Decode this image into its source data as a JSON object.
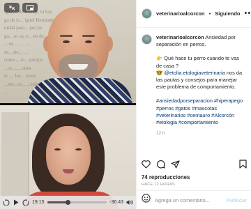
{
  "video": {
    "wall_text": "Qua... Me lo... ay, lo hay\ngo de lo... iguel Hernández \nuidad para... por pa\ngo... or os, e... no de\n... es...  ...  ...\nse... ste...  ...\ncome..., la... porque\n...ce..., ...ones\nte ...  los... rosas\n...nté...ce... ...erdas\n...",
    "time_elapsed": "19:15",
    "time_remaining": "-36:43",
    "progress": 0.35
  },
  "header": {
    "username": "veterinarioalcorcon",
    "separator": "•",
    "follow_state": "Siguiendo",
    "more_label": "•••"
  },
  "caption": {
    "username": "veterinarioalcorcon",
    "line1": "Ansiedad por separación en perros.",
    "line2": "👉 Qué hace tu perro cuando te vas de casa ?",
    "line3_prefix": "🤓 ",
    "line3_mention": "@etolia.etologiaveterinaria",
    "line3_rest": " nos da las pautas y consejos para manejar este problema de comportamiento.",
    "hashtags": "#ansiedadporseparacion #hiperapego #perros #gatos #mascotas #veterinarios #centauro #Alcorcón #etologia #comportamiento",
    "time": "12 h"
  },
  "stats": {
    "views": "74 reproducciones",
    "posted": "HACE 12 HORAS"
  },
  "comment": {
    "placeholder": "Agrega un comentario...",
    "publish_label": "Publicar"
  },
  "colors": {
    "link": "#00376b",
    "publish_disabled": "#b2dffc",
    "muted": "#8e8e8e"
  }
}
